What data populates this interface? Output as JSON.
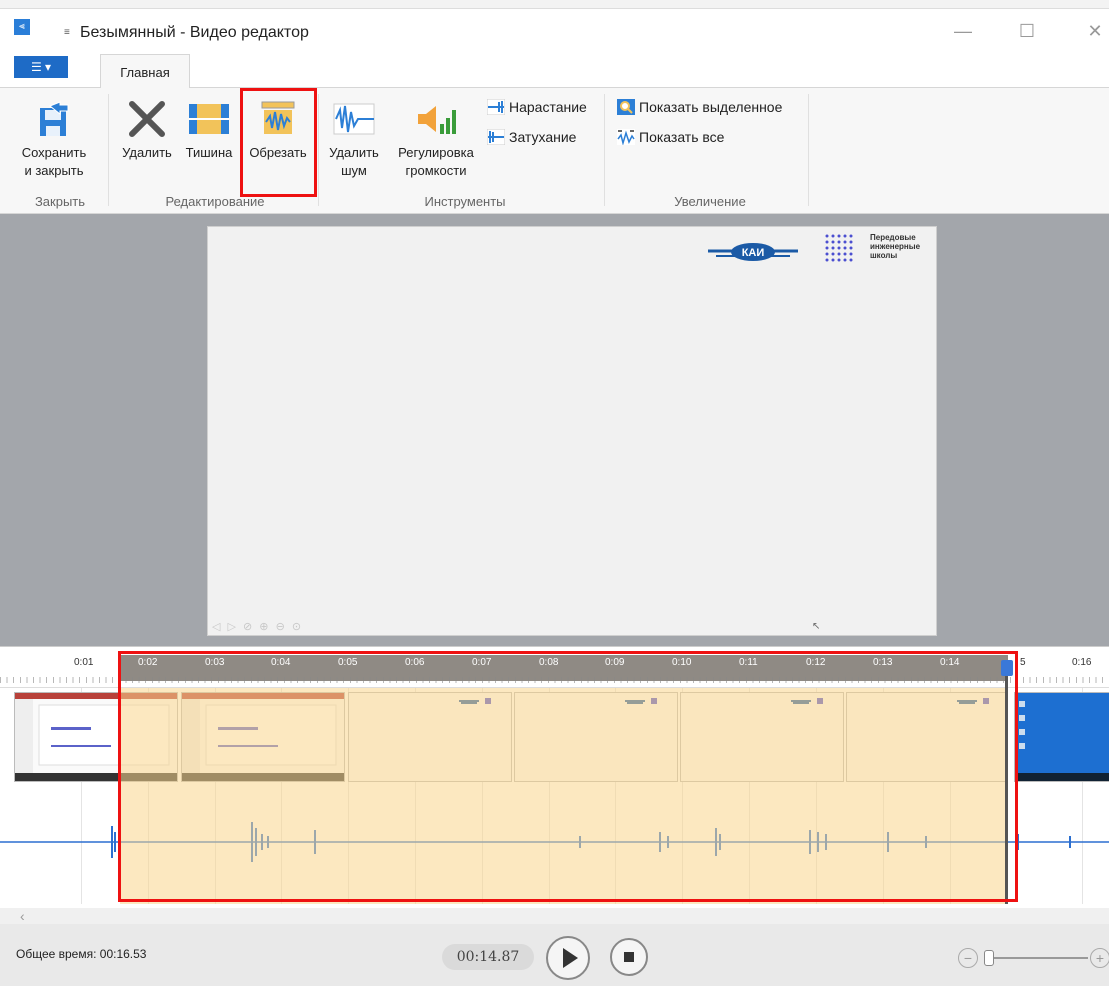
{
  "window": {
    "title": "Безымянный - Видео редактор",
    "qa_glyph": "≡",
    "minimize_glyph": "—",
    "maximize_glyph": "☐",
    "close_glyph": "✕"
  },
  "ribbon": {
    "file_menu_label": "☰ ▾",
    "tab_home": "Главная",
    "buttons": {
      "save_close_line1": "Сохранить",
      "save_close_line2": "и закрыть",
      "delete": "Удалить",
      "silence": "Тишина",
      "trim": "Обрезать",
      "denoise_line1": "Удалить",
      "denoise_line2": "шум",
      "volume_line1": "Регулировка",
      "volume_line2": "громкости",
      "fade_in": "Нарастание",
      "fade_out": "Затухание",
      "show_selected": "Показать выделенное",
      "show_all": "Показать все"
    },
    "groups": {
      "close": "Закрыть",
      "edit": "Редактирование",
      "tools": "Инструменты",
      "zoom": "Увеличение"
    }
  },
  "preview": {
    "logo_line1": "Передовые",
    "logo_line2": "инженерные",
    "logo_line3": "школы",
    "kai_text": "КАИ",
    "slide_controls": "◁ ▷ ⊘ ⊕ ⊖ ⊙"
  },
  "timeline": {
    "ticks": [
      "0:01",
      "0:02",
      "0:03",
      "0:04",
      "0:05",
      "0:06",
      "0:07",
      "0:08",
      "0:09",
      "0:10",
      "0:11",
      "0:12",
      "0:13",
      "0:14",
      "5",
      "0:16"
    ]
  },
  "footer": {
    "total_time": "Общее время: 00:16.53",
    "current_time": "00:14.87",
    "zoom_out_glyph": "−",
    "zoom_in_glyph": "+"
  },
  "colors": {
    "accent": "#1e6bc6",
    "highlight": "#ee1111",
    "selection": "#f9d58c",
    "waveform": "#2b6fd0"
  }
}
